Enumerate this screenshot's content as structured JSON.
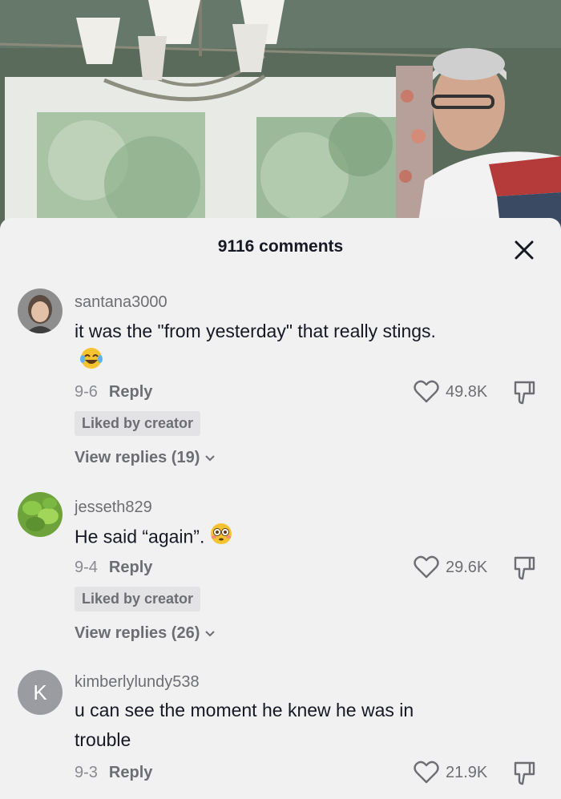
{
  "sheet": {
    "title": "9116 comments"
  },
  "comments": [
    {
      "username": "santana3000",
      "text": "it was the \"from yesterday\" that really stings.",
      "emoji": "tears-of-joy-emoji",
      "date": "9-6",
      "reply_label": "Reply",
      "likes": "49.8K",
      "liked_by_creator": "Liked by creator",
      "view_replies": "View replies (19)",
      "avatar": "profile-photo"
    },
    {
      "username": "jesseth829",
      "text": "He said “again”.",
      "emoji": "flushed-face-emoji",
      "date": "9-4",
      "reply_label": "Reply",
      "likes": "29.6K",
      "liked_by_creator": "Liked by creator",
      "view_replies": "View replies (26)",
      "avatar": "leaf-photo"
    },
    {
      "username": "kimberlylundy538",
      "text": "u can see the moment he knew he was in trouble",
      "date": "9-3",
      "reply_label": "Reply",
      "likes": "21.9K",
      "avatar_letter": "K"
    }
  ],
  "icons": {
    "close": "close-icon",
    "like": "heart-icon",
    "dislike": "thumbs-down-icon",
    "expand": "chevron-down-icon"
  },
  "colors": {
    "sheet_bg": "#f1f1f2",
    "primary_text": "#161823",
    "secondary_text": "#6d6e73",
    "badge_bg": "#e3e3e5"
  }
}
